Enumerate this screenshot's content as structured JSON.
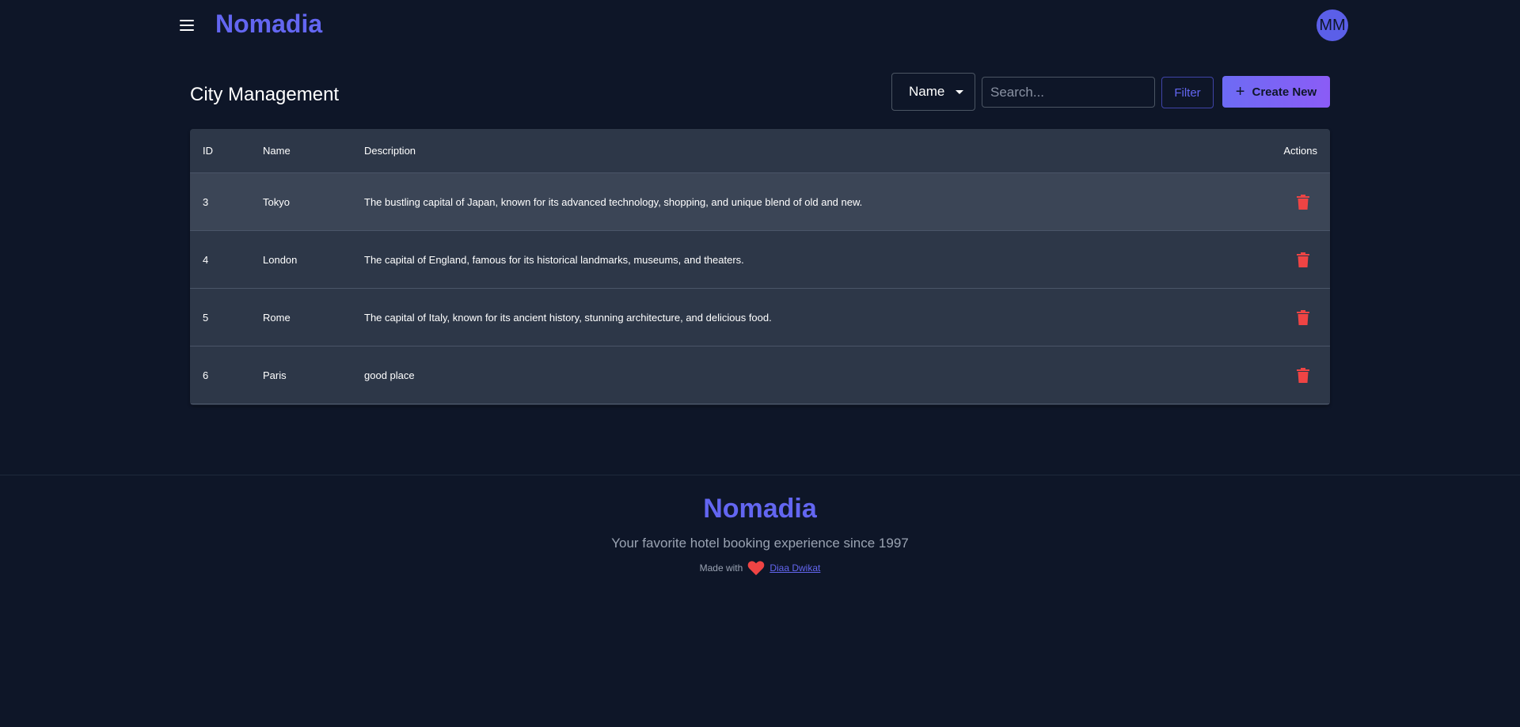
{
  "header": {
    "brand": "Nomadia",
    "avatar_initials": "MM"
  },
  "main": {
    "title": "City Management",
    "sort_select": {
      "value": "Name"
    },
    "search": {
      "placeholder": "Search...",
      "value": ""
    },
    "filter_label": "Filter",
    "create_label": "Create New"
  },
  "table": {
    "columns": {
      "id": "ID",
      "name": "Name",
      "description": "Description",
      "actions": "Actions"
    },
    "rows": [
      {
        "id": "3",
        "name": "Tokyo",
        "description": "The bustling capital of Japan, known for its advanced technology, shopping, and unique blend of old and new."
      },
      {
        "id": "4",
        "name": "London",
        "description": "The capital of England, famous for its historical landmarks, museums, and theaters."
      },
      {
        "id": "5",
        "name": "Rome",
        "description": "The capital of Italy, known for its ancient history, stunning architecture, and delicious food."
      },
      {
        "id": "6",
        "name": "Paris",
        "description": "good place"
      }
    ]
  },
  "footer": {
    "brand": "Nomadia",
    "tagline": "Your favorite hotel booking experience since 1997",
    "made_with": "Made with",
    "author": "Diaa Dwikat"
  },
  "colors": {
    "background": "#0e1628",
    "accent": "#6366f1",
    "delete": "#ef4444",
    "table_bg": "#2d3748"
  },
  "icons": [
    "menu-icon",
    "caret-down-icon",
    "plus-icon",
    "trash-icon",
    "heart-icon"
  ]
}
